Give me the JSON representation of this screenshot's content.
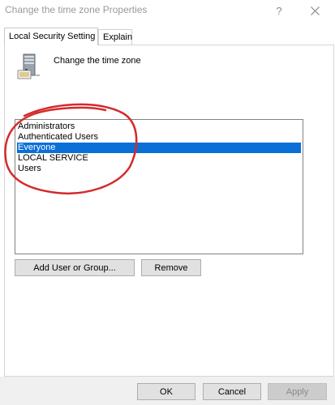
{
  "window": {
    "title": "Change the time zone Properties",
    "help_glyph": "?",
    "close_icon": "close-icon"
  },
  "tabs": [
    {
      "label": "Local Security Setting",
      "active": true
    },
    {
      "label": "Explain",
      "active": false
    }
  ],
  "policy": {
    "icon": "server-computer-icon",
    "title": "Change the time zone"
  },
  "accounts": {
    "items": [
      {
        "label": "Administrators",
        "selected": false
      },
      {
        "label": "Authenticated Users",
        "selected": false
      },
      {
        "label": "Everyone",
        "selected": true
      },
      {
        "label": "LOCAL SERVICE",
        "selected": false
      },
      {
        "label": "Users",
        "selected": false
      }
    ],
    "selection_color": "#0a6fd6"
  },
  "actions": {
    "add_label": "Add User or Group...",
    "remove_label": "Remove"
  },
  "footer": {
    "ok_label": "OK",
    "cancel_label": "Cancel",
    "apply_label": "Apply",
    "apply_enabled": false
  },
  "annotation": {
    "shape": "hand-drawn ellipse",
    "color": "#d42a2a"
  }
}
